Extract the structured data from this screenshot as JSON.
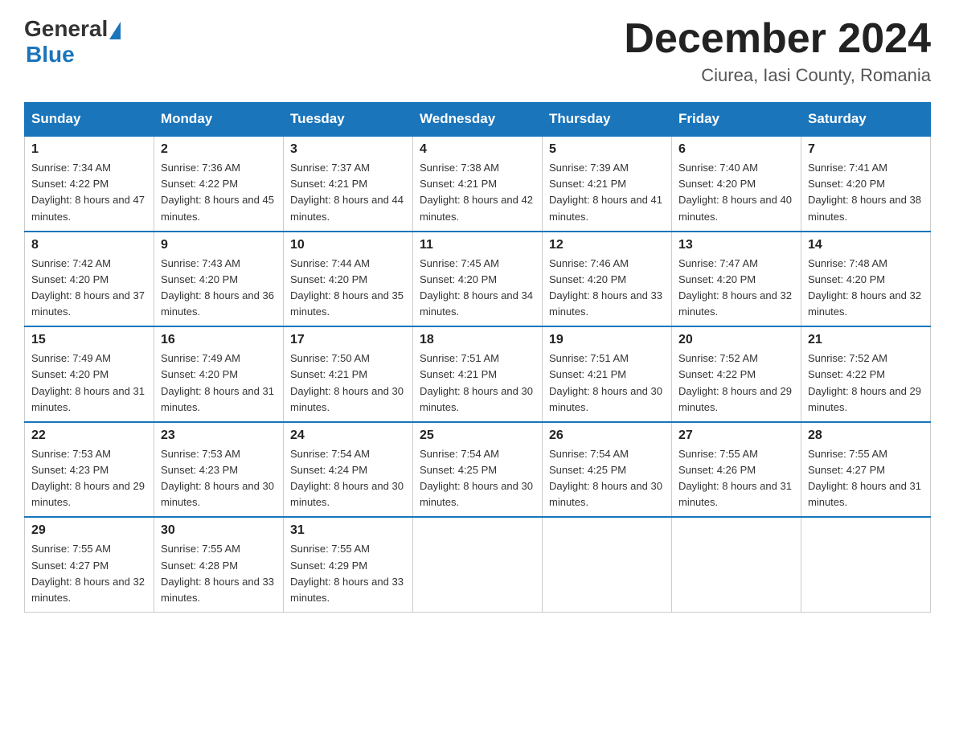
{
  "header": {
    "logo_general": "General",
    "logo_blue": "Blue",
    "month_title": "December 2024",
    "location": "Ciurea, Iasi County, Romania"
  },
  "days_of_week": [
    "Sunday",
    "Monday",
    "Tuesday",
    "Wednesday",
    "Thursday",
    "Friday",
    "Saturday"
  ],
  "weeks": [
    [
      {
        "day": "1",
        "sunrise": "7:34 AM",
        "sunset": "4:22 PM",
        "daylight": "8 hours and 47 minutes."
      },
      {
        "day": "2",
        "sunrise": "7:36 AM",
        "sunset": "4:22 PM",
        "daylight": "8 hours and 45 minutes."
      },
      {
        "day": "3",
        "sunrise": "7:37 AM",
        "sunset": "4:21 PM",
        "daylight": "8 hours and 44 minutes."
      },
      {
        "day": "4",
        "sunrise": "7:38 AM",
        "sunset": "4:21 PM",
        "daylight": "8 hours and 42 minutes."
      },
      {
        "day": "5",
        "sunrise": "7:39 AM",
        "sunset": "4:21 PM",
        "daylight": "8 hours and 41 minutes."
      },
      {
        "day": "6",
        "sunrise": "7:40 AM",
        "sunset": "4:20 PM",
        "daylight": "8 hours and 40 minutes."
      },
      {
        "day": "7",
        "sunrise": "7:41 AM",
        "sunset": "4:20 PM",
        "daylight": "8 hours and 38 minutes."
      }
    ],
    [
      {
        "day": "8",
        "sunrise": "7:42 AM",
        "sunset": "4:20 PM",
        "daylight": "8 hours and 37 minutes."
      },
      {
        "day": "9",
        "sunrise": "7:43 AM",
        "sunset": "4:20 PM",
        "daylight": "8 hours and 36 minutes."
      },
      {
        "day": "10",
        "sunrise": "7:44 AM",
        "sunset": "4:20 PM",
        "daylight": "8 hours and 35 minutes."
      },
      {
        "day": "11",
        "sunrise": "7:45 AM",
        "sunset": "4:20 PM",
        "daylight": "8 hours and 34 minutes."
      },
      {
        "day": "12",
        "sunrise": "7:46 AM",
        "sunset": "4:20 PM",
        "daylight": "8 hours and 33 minutes."
      },
      {
        "day": "13",
        "sunrise": "7:47 AM",
        "sunset": "4:20 PM",
        "daylight": "8 hours and 32 minutes."
      },
      {
        "day": "14",
        "sunrise": "7:48 AM",
        "sunset": "4:20 PM",
        "daylight": "8 hours and 32 minutes."
      }
    ],
    [
      {
        "day": "15",
        "sunrise": "7:49 AM",
        "sunset": "4:20 PM",
        "daylight": "8 hours and 31 minutes."
      },
      {
        "day": "16",
        "sunrise": "7:49 AM",
        "sunset": "4:20 PM",
        "daylight": "8 hours and 31 minutes."
      },
      {
        "day": "17",
        "sunrise": "7:50 AM",
        "sunset": "4:21 PM",
        "daylight": "8 hours and 30 minutes."
      },
      {
        "day": "18",
        "sunrise": "7:51 AM",
        "sunset": "4:21 PM",
        "daylight": "8 hours and 30 minutes."
      },
      {
        "day": "19",
        "sunrise": "7:51 AM",
        "sunset": "4:21 PM",
        "daylight": "8 hours and 30 minutes."
      },
      {
        "day": "20",
        "sunrise": "7:52 AM",
        "sunset": "4:22 PM",
        "daylight": "8 hours and 29 minutes."
      },
      {
        "day": "21",
        "sunrise": "7:52 AM",
        "sunset": "4:22 PM",
        "daylight": "8 hours and 29 minutes."
      }
    ],
    [
      {
        "day": "22",
        "sunrise": "7:53 AM",
        "sunset": "4:23 PM",
        "daylight": "8 hours and 29 minutes."
      },
      {
        "day": "23",
        "sunrise": "7:53 AM",
        "sunset": "4:23 PM",
        "daylight": "8 hours and 30 minutes."
      },
      {
        "day": "24",
        "sunrise": "7:54 AM",
        "sunset": "4:24 PM",
        "daylight": "8 hours and 30 minutes."
      },
      {
        "day": "25",
        "sunrise": "7:54 AM",
        "sunset": "4:25 PM",
        "daylight": "8 hours and 30 minutes."
      },
      {
        "day": "26",
        "sunrise": "7:54 AM",
        "sunset": "4:25 PM",
        "daylight": "8 hours and 30 minutes."
      },
      {
        "day": "27",
        "sunrise": "7:55 AM",
        "sunset": "4:26 PM",
        "daylight": "8 hours and 31 minutes."
      },
      {
        "day": "28",
        "sunrise": "7:55 AM",
        "sunset": "4:27 PM",
        "daylight": "8 hours and 31 minutes."
      }
    ],
    [
      {
        "day": "29",
        "sunrise": "7:55 AM",
        "sunset": "4:27 PM",
        "daylight": "8 hours and 32 minutes."
      },
      {
        "day": "30",
        "sunrise": "7:55 AM",
        "sunset": "4:28 PM",
        "daylight": "8 hours and 33 minutes."
      },
      {
        "day": "31",
        "sunrise": "7:55 AM",
        "sunset": "4:29 PM",
        "daylight": "8 hours and 33 minutes."
      },
      null,
      null,
      null,
      null
    ]
  ],
  "labels": {
    "sunrise": "Sunrise:",
    "sunset": "Sunset:",
    "daylight": "Daylight:"
  }
}
